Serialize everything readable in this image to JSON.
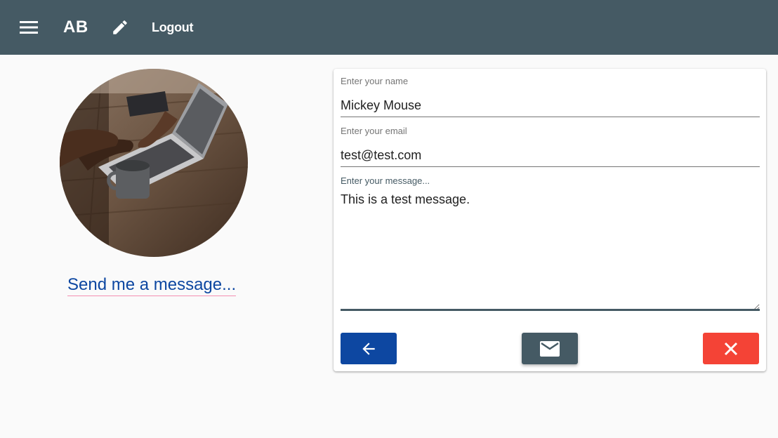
{
  "toolbar": {
    "menu_icon": "menu-icon",
    "brand": "AB",
    "edit_icon": "pencil-icon",
    "logout_label": "Logout",
    "background_color": "#455a64"
  },
  "sidebar": {
    "avatar_description": "laptop-on-desk-photo",
    "send_link_label": "Send me a message...",
    "link_color": "#0d47a1"
  },
  "form": {
    "name": {
      "label": "Enter your name",
      "value": "Mickey Mouse"
    },
    "email": {
      "label": "Enter your email",
      "value": "test@test.com"
    },
    "message": {
      "label": "Enter your message...",
      "value": "This is a test message."
    },
    "buttons": {
      "back_icon": "arrow-left-icon",
      "send_icon": "mail-icon",
      "close_icon": "close-icon",
      "back_color": "#0d47a1",
      "send_color": "#455a64",
      "close_color": "#f44336"
    }
  }
}
